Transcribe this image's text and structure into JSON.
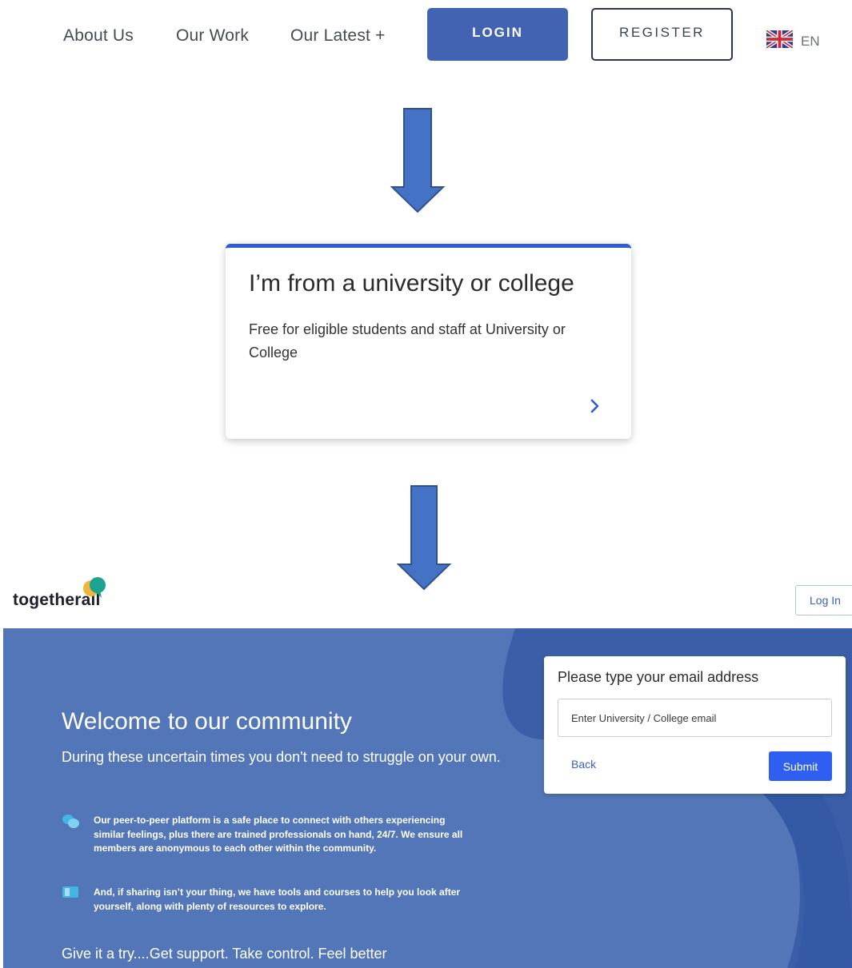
{
  "nav": {
    "links": [
      "About Us",
      "Our Work",
      "Our Latest +"
    ],
    "login_label": "LOGIN",
    "register_label": "REGISTER",
    "language": "EN"
  },
  "card": {
    "title": "I’m from a university or college",
    "text": "Free for eligible students and staff at University or College"
  },
  "togetherall": {
    "logo_text": "togetherall",
    "login_label": "Log In",
    "hero": {
      "title": "Welcome to our community",
      "subtitle": "During these uncertain times you don't need to struggle on your own.",
      "features": [
        "Our peer-to-peer platform is a safe place to connect with others experiencing similar feelings, plus there are trained professionals on hand, 24/7. We ensure all members are anonymous to each other within the community.",
        "And, if sharing isn’t your thing, we have tools and courses to help you look after yourself, along with plenty of resources to explore."
      ],
      "cta": "Give it a try....Get support. Take control. Feel better"
    },
    "email_form": {
      "label": "Please type your email address",
      "placeholder": "Enter University / College email",
      "back_label": "Back",
      "submit_label": "Submit"
    }
  },
  "colors": {
    "primary_blue": "#4263b2",
    "hero_blue": "#5276b7",
    "submit_blue": "#2f5ff0",
    "arrow_fill": "#4472c4",
    "arrow_stroke": "#2f528f"
  }
}
